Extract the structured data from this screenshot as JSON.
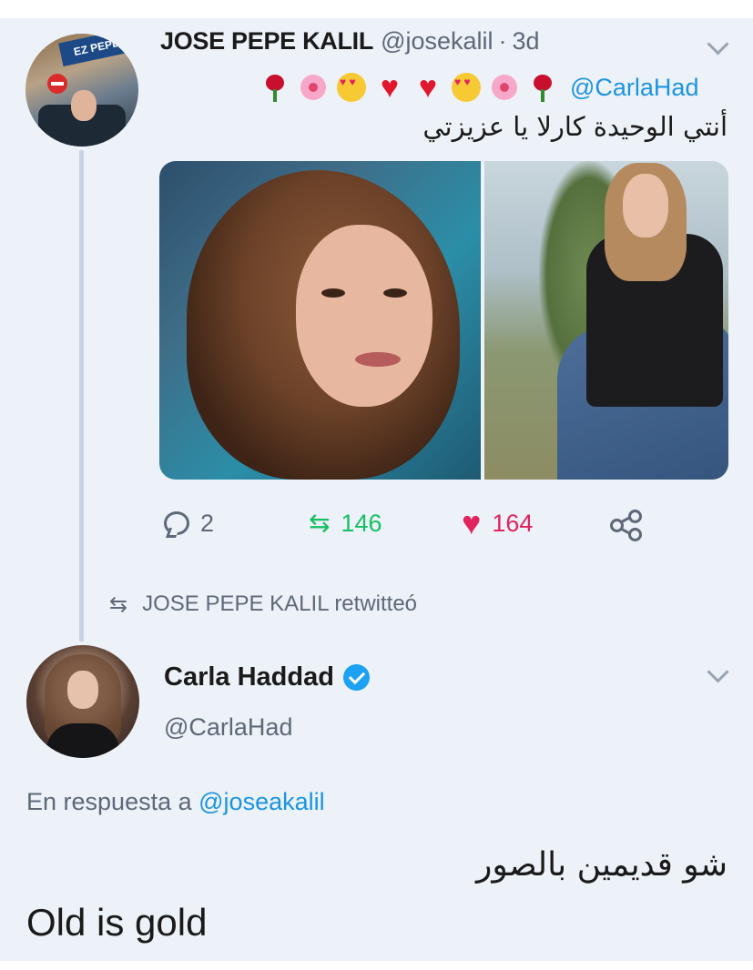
{
  "tweet": {
    "author_name": "JOSE PEPE KALIL",
    "author_handle": "@josekalil",
    "separator": "·",
    "time": "3d",
    "emojis": [
      "rose-icon",
      "blossom-icon",
      "heart-eyes-icon",
      "red-heart-icon",
      "red-heart-icon",
      "heart-eyes-icon",
      "blossom-icon",
      "rose-icon"
    ],
    "mention": "@CarlaHad",
    "text_arabic": "أنتي الوحيدة كارلا يا عزيزتي",
    "avatar_sign": "EZ PEPE",
    "reply_count": "2",
    "retweet_count": "146",
    "like_count": "164"
  },
  "retweet_note": {
    "label": "JOSE PEPE KALIL retwitteó"
  },
  "reply": {
    "author_name": "Carla Haddad",
    "author_handle": "@CarlaHad",
    "in_reply_prefix": "En respuesta a",
    "in_reply_mention": "@joseakalil",
    "text_arabic": "شو قديمين بالصور",
    "text": "Old is gold"
  },
  "colors": {
    "background": "#edf1f8",
    "link": "#1b95e0",
    "retweet": "#17bf63",
    "like": "#e0245e",
    "muted": "#5d6978"
  }
}
